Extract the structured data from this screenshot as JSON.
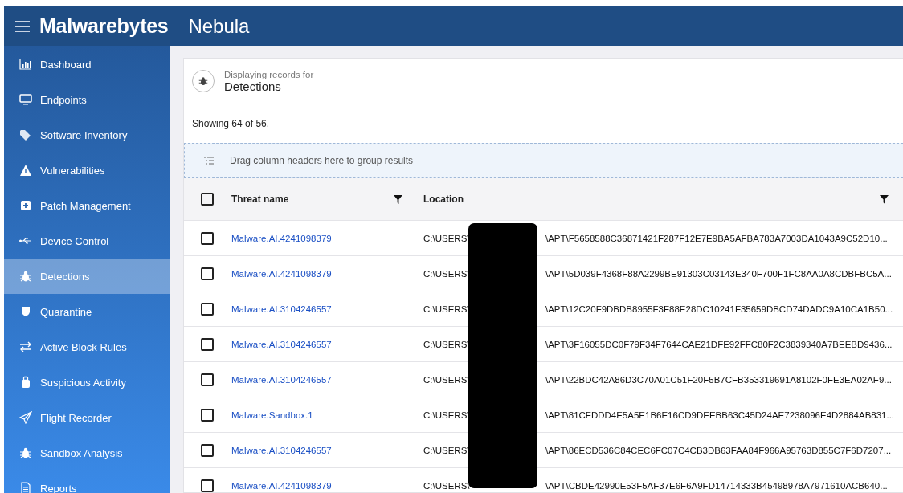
{
  "topbar": {
    "brand": "Malwarebytes",
    "product": "Nebula"
  },
  "sidebar": {
    "items": [
      {
        "label": "Dashboard",
        "kind": "chart",
        "selected": false
      },
      {
        "label": "Endpoints",
        "kind": "monitor",
        "selected": false
      },
      {
        "label": "Software Inventory",
        "kind": "tag",
        "selected": false
      },
      {
        "label": "Vulnerabilities",
        "kind": "warning",
        "selected": false
      },
      {
        "label": "Patch Management",
        "kind": "plus",
        "selected": false
      },
      {
        "label": "Device Control",
        "kind": "usb",
        "selected": false
      },
      {
        "label": "Detections",
        "kind": "bug",
        "selected": true
      },
      {
        "label": "Quarantine",
        "kind": "shield",
        "selected": false
      },
      {
        "label": "Active Block Rules",
        "kind": "arrows",
        "selected": false
      },
      {
        "label": "Suspicious Activity",
        "kind": "bag",
        "selected": false
      },
      {
        "label": "Flight Recorder",
        "kind": "plane",
        "selected": false
      },
      {
        "label": "Sandbox Analysis",
        "kind": "bug",
        "selected": false
      },
      {
        "label": "Reports",
        "kind": "doc",
        "selected": false
      }
    ]
  },
  "header": {
    "caption": "Displaying records for",
    "title": "Detections"
  },
  "summary": "Showing 64 of 56.",
  "group_panel": {
    "placeholder": "Drag column headers here to group results"
  },
  "table": {
    "columns": [
      {
        "label": "Threat name"
      },
      {
        "label": "Location"
      }
    ],
    "select_all_checked": false,
    "rows": [
      {
        "checked": false,
        "threat": "Malware.AI.4241098379",
        "location_start": "C:\\USERS\\",
        "location_end": "\\APT\\F5658588C36871421F287F12E7E9BA5AFBA783A7003DA1043A9C52D10..."
      },
      {
        "checked": false,
        "threat": "Malware.AI.4241098379",
        "location_start": "C:\\USERS\\",
        "location_end": "\\APT\\5D039F4368F88A2299BE91303C03143E340F700F1FC8AA0A8CDBFBC5A..."
      },
      {
        "checked": false,
        "threat": "Malware.AI.3104246557",
        "location_start": "C:\\USERS\\",
        "location_end": "\\APT\\12C20F9DBDB8955F3F88E28DC10241F35659DBCD74DADC9A10CA1B50..."
      },
      {
        "checked": false,
        "threat": "Malware.AI.3104246557",
        "location_start": "C:\\USERS\\",
        "location_end": "\\APT\\3F16055DC0F79F34F7644CAE21DFE92FFC80F2C3839340A7BEEBD9436..."
      },
      {
        "checked": false,
        "threat": "Malware.AI.3104246557",
        "location_start": "C:\\USERS\\",
        "location_end": "\\APT\\22BDC42A86D3C70A01C51F20F5B7CFB353319691A8102F0FE3EA02AF9..."
      },
      {
        "checked": false,
        "threat": "Malware.Sandbox.1",
        "location_start": "C:\\USERS\\",
        "location_end": "\\APT\\81CFDDD4E5A5E1B6E16CD9DEEBB63C45D24AE7238096E4D2884AB831..."
      },
      {
        "checked": false,
        "threat": "Malware.AI.3104246557",
        "location_start": "C:\\USERS\\",
        "location_end": "\\APT\\86ECD536C84CEC6FC07C4CB3DB63FAA84F966A95763D855C7F6D7207..."
      },
      {
        "checked": false,
        "threat": "Malware.AI.4241098379",
        "location_start": "C:\\USERS\\",
        "location_end": "\\APT\\CBDE42990E53F5AF37E6F6A9FD14714333B45498978A7971610ACB640..."
      }
    ]
  }
}
